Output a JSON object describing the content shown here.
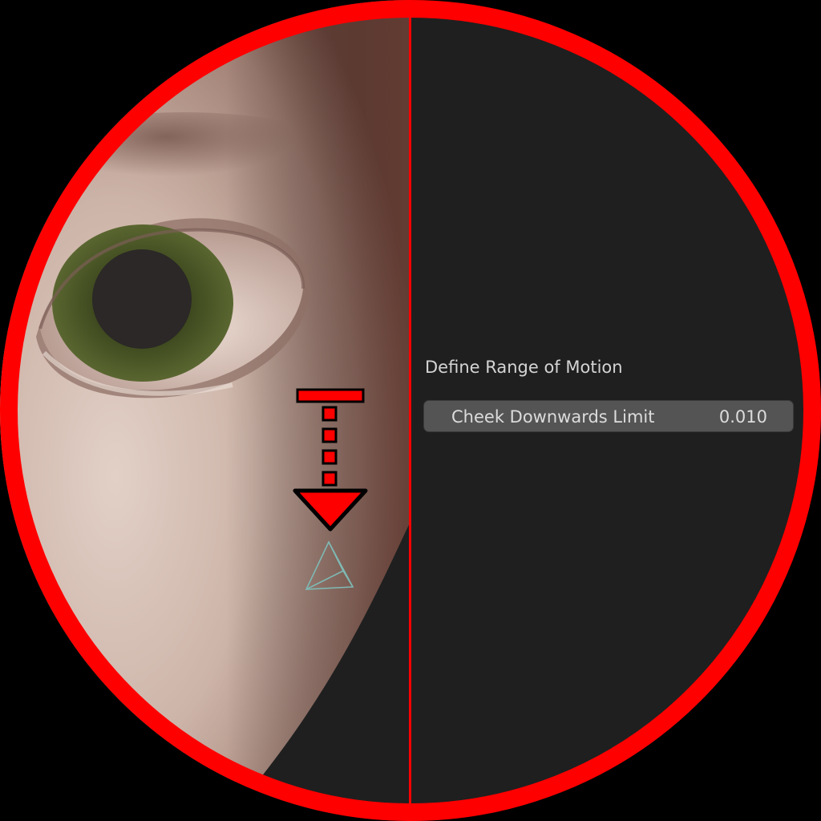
{
  "viewport": {
    "background_color": "#1f1f1f",
    "skin_color": "#cdb3a6",
    "iris_color": "#4d5a28",
    "indicator_color": "#ff0000",
    "bone_widget_color": "#7fb8b3",
    "icons": [
      "down-arrow-icon",
      "bone-widget-icon"
    ]
  },
  "panel": {
    "title": "Define Range of Motion",
    "slider": {
      "label": "Cheek Downwards Limit",
      "value": "0.010"
    }
  },
  "frame": {
    "ring_color": "#ff0000",
    "divider_color": "#ff0000"
  }
}
